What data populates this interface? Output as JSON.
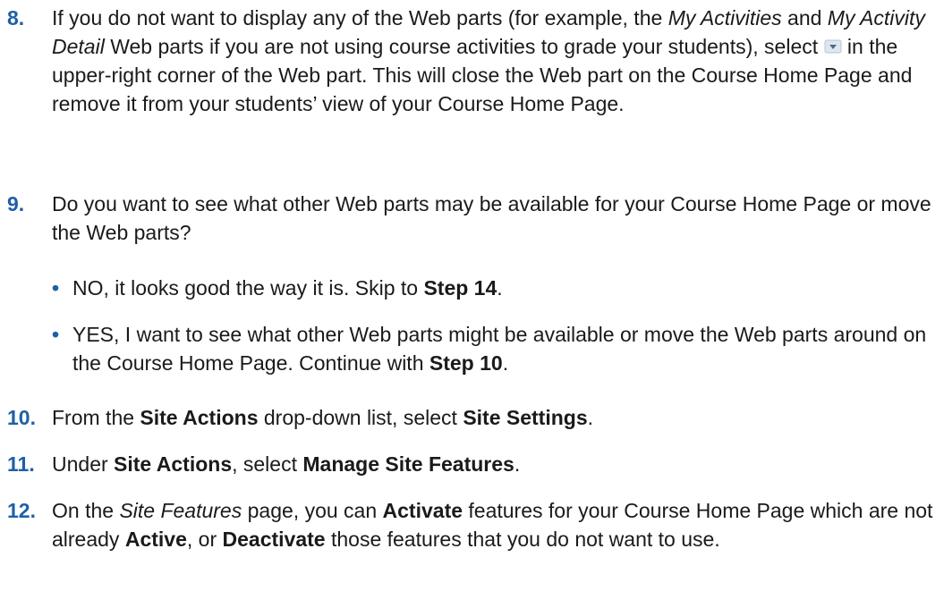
{
  "steps": [
    {
      "number": "8.",
      "segments": [
        {
          "t": "If you do not want to display any of the Web parts (for example, the "
        },
        {
          "t": "My Activities",
          "s": "i"
        },
        {
          "t": " and "
        },
        {
          "t": "My Activity Detail",
          "s": "i"
        },
        {
          "t": " Web parts if you are not using course activities to grade your students), select "
        },
        {
          "icon": "dropdown-arrow-icon"
        },
        {
          "t": " in the upper-right corner of the Web part. This will close the Web part on the Course Home Page and remove it from your students’ view of your Course Home Page."
        }
      ]
    },
    {
      "number": "9.",
      "segments": [
        {
          "t": "Do you want to see what other Web parts may be available for your Course Home Page or move the Web parts?"
        }
      ]
    },
    {
      "number": "10.",
      "segments": [
        {
          "t": "From the "
        },
        {
          "t": "Site Actions",
          "s": "b"
        },
        {
          "t": " drop-down list, select "
        },
        {
          "t": "Site Settings",
          "s": "b"
        },
        {
          "t": "."
        }
      ]
    },
    {
      "number": "11.",
      "segments": [
        {
          "t": "Under "
        },
        {
          "t": "Site Actions",
          "s": "b"
        },
        {
          "t": ", select "
        },
        {
          "t": "Manage Site Features",
          "s": "b"
        },
        {
          "t": "."
        }
      ]
    },
    {
      "number": "12.",
      "segments": [
        {
          "t": "On the "
        },
        {
          "t": "Site Features",
          "s": "i"
        },
        {
          "t": " page, you can "
        },
        {
          "t": "Activate",
          "s": "b"
        },
        {
          "t": " features for your Course Home Page which are not already "
        },
        {
          "t": "Active",
          "s": "b"
        },
        {
          "t": ", or "
        },
        {
          "t": "Deactivate",
          "s": "b"
        },
        {
          "t": " those features that you do not want to use."
        }
      ]
    }
  ],
  "step9_options": [
    {
      "bullet": "•",
      "segments": [
        {
          "t": "NO, it looks good the way it is. Skip to "
        },
        {
          "t": "Step 14",
          "s": "b"
        },
        {
          "t": "."
        }
      ]
    },
    {
      "bullet": "•",
      "segments": [
        {
          "t": "YES, I want to see what other Web parts might be available or move the Web parts around on the Course Home Page. Continue with "
        },
        {
          "t": "Step 10",
          "s": "b"
        },
        {
          "t": "."
        }
      ]
    }
  ],
  "colors": {
    "number": "#1f5fa8",
    "text": "#1a1a1a"
  }
}
